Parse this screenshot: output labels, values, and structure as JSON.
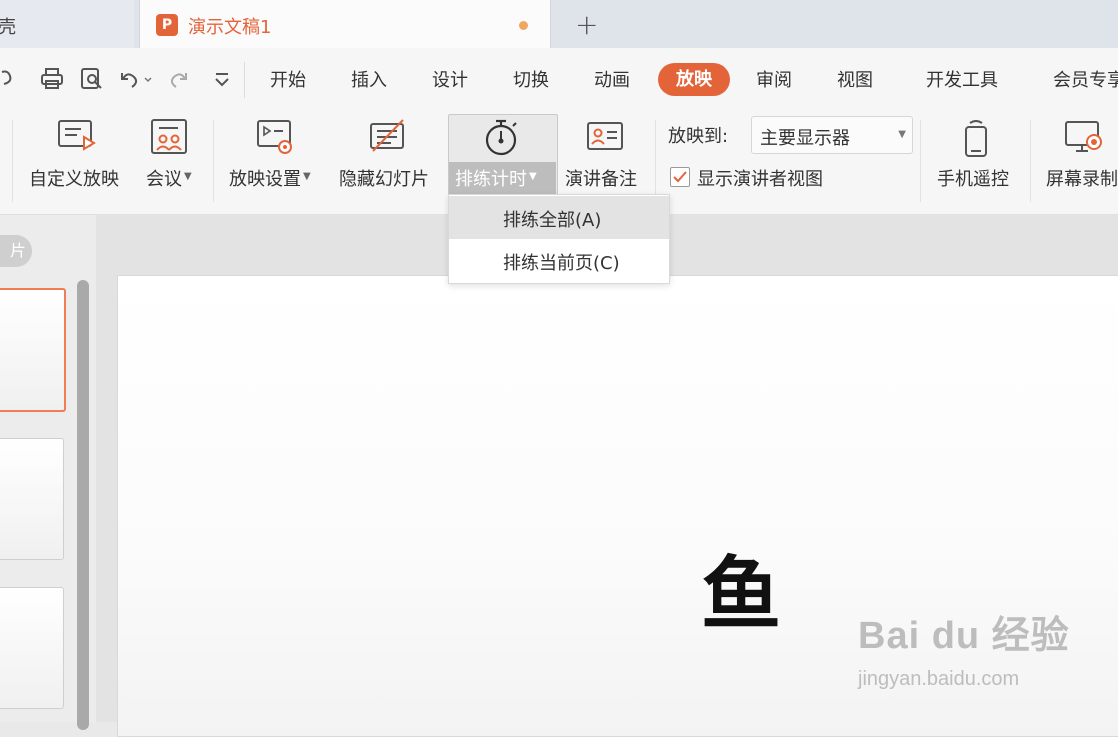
{
  "tabs": {
    "previous_tab_text": "壳",
    "logo_letter": "P",
    "active_title": "演示文稿1",
    "new_tab": "+"
  },
  "menu": {
    "items": [
      "开始",
      "插入",
      "设计",
      "切换",
      "动画",
      "放映",
      "审阅",
      "视图",
      "开发工具",
      "会员专享"
    ],
    "active": "放映"
  },
  "ribbon": {
    "custom_show": "自定义放映",
    "meeting": "会议",
    "show_settings": "放映设置",
    "hide_slide": "隐藏幻灯片",
    "rehearse_timing": "排练计时",
    "speaker_notes": "演讲备注",
    "output_label": "放映到:",
    "output_value": "主要显示器",
    "presenter_view_label": "显示演讲者视图",
    "presenter_view_checked": true,
    "phone_remote": "手机遥控",
    "screen_record": "屏幕录制"
  },
  "dropdown": {
    "items": [
      "排练全部(A)",
      "排练当前页(C)"
    ],
    "highlighted": "排练全部(A)"
  },
  "left_panel": {
    "tab_label": "片"
  },
  "slide": {
    "text": "鱼"
  },
  "watermark": {
    "main": "Bai du 经验",
    "sub": "jingyan.baidu.com"
  },
  "colors": {
    "accent": "#e4643a",
    "unsaved_dot": "#f0a760",
    "thumb_border_active": "#f07e55"
  }
}
